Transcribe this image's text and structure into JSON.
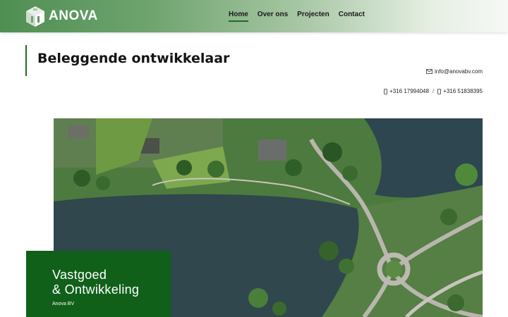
{
  "brand": {
    "name": "ANOVA"
  },
  "nav": {
    "items": [
      {
        "label": "Home",
        "active": true
      },
      {
        "label": "Over ons",
        "active": false
      },
      {
        "label": "Projecten",
        "active": false
      },
      {
        "label": "Contact",
        "active": false
      }
    ]
  },
  "page": {
    "title": "Beleggende ontwikkelaar"
  },
  "contact": {
    "email": "info@anovabv.com",
    "phone_1": "+316 17994048",
    "separator": "/",
    "phone_2": "+316 51838395"
  },
  "hero": {
    "caption_line_1": "Vastgoed",
    "caption_line_2": "& Ontwikkeling",
    "caption_sub": "Anova BV"
  },
  "colors": {
    "brand_green": "#10601a",
    "accent_green": "#1f6b22",
    "header_gradient_start": "#4f8f52"
  }
}
